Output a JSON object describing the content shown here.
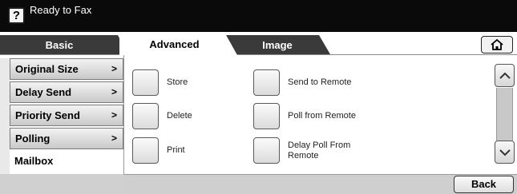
{
  "status": {
    "help_label": "?",
    "text": "Ready to Fax"
  },
  "tabs": [
    {
      "label": "Basic"
    },
    {
      "label": "Advanced",
      "active": true
    },
    {
      "label": "Image"
    }
  ],
  "home_icon": "home-icon",
  "menu": [
    {
      "label": "Original Size",
      "chevron": ">"
    },
    {
      "label": "Delay Send",
      "chevron": ">"
    },
    {
      "label": "Priority Send",
      "chevron": ">"
    },
    {
      "label": "Polling",
      "chevron": ">"
    },
    {
      "label": "Mailbox",
      "selected": true
    }
  ],
  "options": {
    "store": "Store",
    "delete": "Delete",
    "print": "Print",
    "send_to_remote": "Send to Remote",
    "poll_from_remote": "Poll from Remote",
    "delay_poll_from_remote": "Delay Poll From Remote"
  },
  "scroll": {
    "up_icon": "chevron-up-icon",
    "down_icon": "chevron-down-icon"
  },
  "back_label": "Back",
  "colors": {
    "status_bar": "#0a0a0a",
    "tab_inactive": "#3a3a3a",
    "tab_active": "#ffffff"
  }
}
